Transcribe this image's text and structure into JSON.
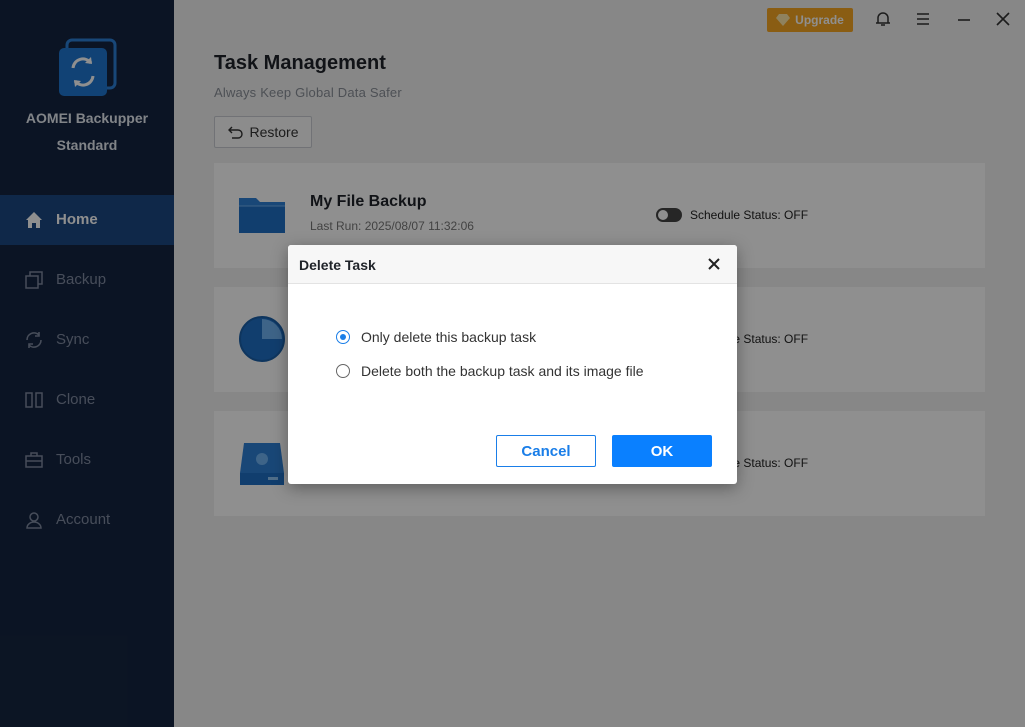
{
  "app": {
    "name_line1": "AOMEI Backupper",
    "name_line2": "Standard",
    "upgrade_label": "Upgrade"
  },
  "sidebar": {
    "items": [
      {
        "label": "Home",
        "icon": "home-icon",
        "active": true
      },
      {
        "label": "Backup",
        "icon": "backup-icon",
        "active": false
      },
      {
        "label": "Sync",
        "icon": "sync-icon",
        "active": false
      },
      {
        "label": "Clone",
        "icon": "clone-icon",
        "active": false
      },
      {
        "label": "Tools",
        "icon": "tools-icon",
        "active": false
      },
      {
        "label": "Account",
        "icon": "account-icon",
        "active": false
      }
    ]
  },
  "main": {
    "title": "Task Management",
    "subtitle": "Always Keep Global Data Safer",
    "restore_label": "Restore",
    "tasks": [
      {
        "name": "My File Backup",
        "last_run": "Last Run: 2025/08/07 11:32:06",
        "schedule": "Schedule Status: OFF",
        "icon": "folder-icon"
      },
      {
        "schedule": "Schedule Status: OFF",
        "icon": "partition-icon"
      },
      {
        "schedule": "Schedule Status: OFF",
        "icon": "disk-icon"
      }
    ]
  },
  "dialog": {
    "title": "Delete Task",
    "options": [
      {
        "label": "Only delete this backup task",
        "selected": true
      },
      {
        "label": "Delete both the backup task and its image file",
        "selected": false
      }
    ],
    "cancel_label": "Cancel",
    "ok_label": "OK"
  },
  "colors": {
    "sidebar_bg": "#152540",
    "active_nav_bg": "#1c4883",
    "upgrade_bg": "#f6a623",
    "primary": "#0a80ff"
  }
}
